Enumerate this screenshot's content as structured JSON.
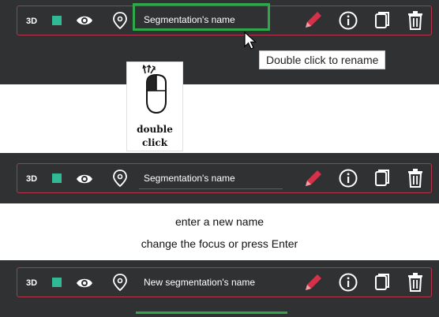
{
  "colors": {
    "panel_bg": "#2f3133",
    "border_accent": "#b8344d",
    "segment_swatch": "#31b894",
    "highlight_green": "#2ea84b"
  },
  "row1": {
    "label_3d": "3D",
    "name": "Segmentation's name",
    "tooltip": "Double click to rename"
  },
  "mouse": {
    "line1": "double",
    "line2": "click"
  },
  "row2": {
    "label_3d": "3D",
    "name": "Segmentation's name"
  },
  "captions": {
    "line1": "enter a new name",
    "line2": "change the focus or press Enter"
  },
  "row3": {
    "label_3d": "3D",
    "name": "New segmentation's name"
  },
  "icons": [
    "visibility-eye-icon",
    "location-pin-icon",
    "pencil-icon",
    "info-icon",
    "copy-icon",
    "trash-icon"
  ]
}
